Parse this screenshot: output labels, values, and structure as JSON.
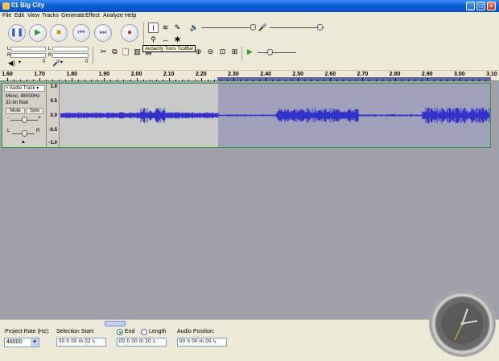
{
  "window": {
    "title": "01 Big City",
    "controls": [
      "_",
      "□",
      "×"
    ]
  },
  "menu": [
    "File",
    "Edit",
    "View",
    "Tracks",
    "Generate",
    "Effect",
    "Analyze",
    "Help"
  ],
  "transport": [
    "pause",
    "play",
    "stop",
    "skip-start",
    "skip-end",
    "record"
  ],
  "tools": {
    "tooltip": "Audacity Tools ToolBar"
  },
  "meters": {
    "l_label": "L",
    "r_label": "R",
    "db_0": "0",
    "db_0b": "0"
  },
  "ruler": {
    "ticks": [
      "1.60",
      "1.70",
      "1.80",
      "1.90",
      "2.00",
      "2.10",
      "2.20",
      "2.30",
      "2.40",
      "2.50",
      "2.60",
      "2.70",
      "2.80",
      "2.90",
      "3.00",
      "3.10"
    ]
  },
  "track": {
    "name": "Audio Track",
    "format": "Mono, 48000Hz",
    "bits": "32-bit float",
    "mute": "Mute",
    "solo": "Solo",
    "gain_minus": "-",
    "gain_plus": "+",
    "pan_l": "L",
    "pan_r": "R",
    "scale": [
      "1.0",
      "0.5",
      "0.0",
      "-0.5",
      "-1.0"
    ]
  },
  "selection_bar": {
    "project_rate_label": "Project Rate (Hz):",
    "project_rate": "48000",
    "selection_start_label": "Selection Start:",
    "selection_start": "00 h 00 m 02 s",
    "end_label": "End",
    "length_label": "Length",
    "end_value": "00 h 00 m 20 s",
    "audio_position_label": "Audio Position:",
    "audio_position": "00 h 00 m 00 s"
  },
  "colors": {
    "selection": "#5c6aa0",
    "waveform": "#3232c8",
    "track_border": "#2e9e2e"
  }
}
